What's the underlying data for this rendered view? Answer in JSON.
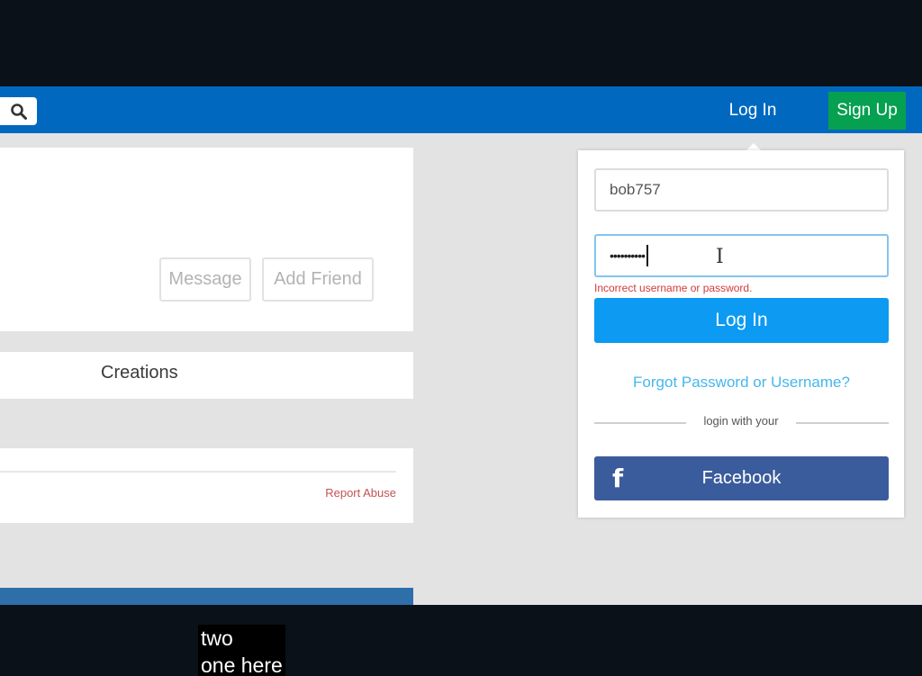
{
  "nav": {
    "login_label": "Log In",
    "signup_label": "Sign Up"
  },
  "profile": {
    "message_label": "Message",
    "add_friend_label": "Add Friend"
  },
  "tabs": {
    "creations_label": "Creations"
  },
  "comments": {
    "report_abuse_label": "Report Abuse"
  },
  "login_form": {
    "username_value": "bob757",
    "password_value": "••••••••••",
    "error_message": "Incorrect username or password.",
    "submit_label": "Log In",
    "forgot_link": "Forgot Password or Username?",
    "divider_text": "login with your",
    "facebook_label": "Facebook",
    "facebook_icon": "f"
  },
  "subtitle": {
    "line1": "two",
    "line2": "one here"
  },
  "colors": {
    "nav_blue": "#0069bf",
    "signup_green": "#06a051",
    "login_button_blue": "#0c9af2",
    "facebook_blue": "#3a5c9c",
    "error_red": "#d23b3b"
  }
}
